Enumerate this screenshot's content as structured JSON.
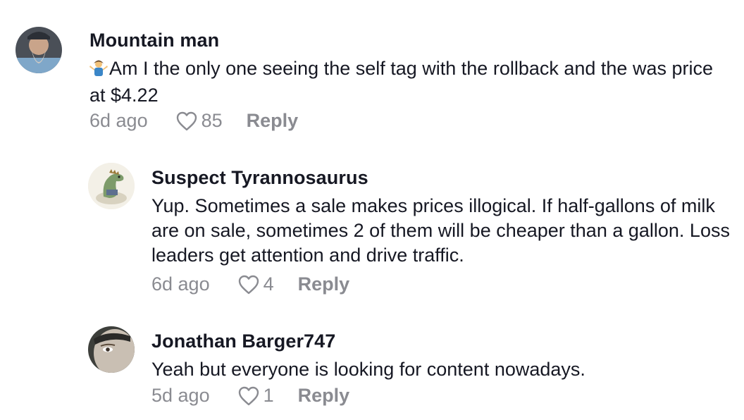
{
  "comments": [
    {
      "username": "Mountain man",
      "emoji_icon": "person-shrugging-emoji",
      "text": "Am I the only one seeing the self tag with the rollback and the was price at $4.22",
      "time": "6d ago",
      "likes": "85",
      "reply_label": "Reply"
    },
    {
      "username": "Suspect Tyrannosaurus",
      "text": "Yup. Sometimes a sale makes prices illogical. If half-gallons of milk are on sale, sometimes 2 of them will be cheaper than a gallon. Loss leaders get attention and drive traffic.",
      "time": "6d ago",
      "likes": "4",
      "reply_label": "Reply"
    },
    {
      "username": "Jonathan Barger747",
      "text": "Yeah but everyone is looking for content nowadays.",
      "time": "5d ago",
      "likes": "1",
      "reply_label": "Reply"
    }
  ],
  "icons": {
    "like": "heart-outline-icon"
  },
  "colors": {
    "text": "#161823",
    "muted": "#8a8b91",
    "background": "#ffffff"
  }
}
